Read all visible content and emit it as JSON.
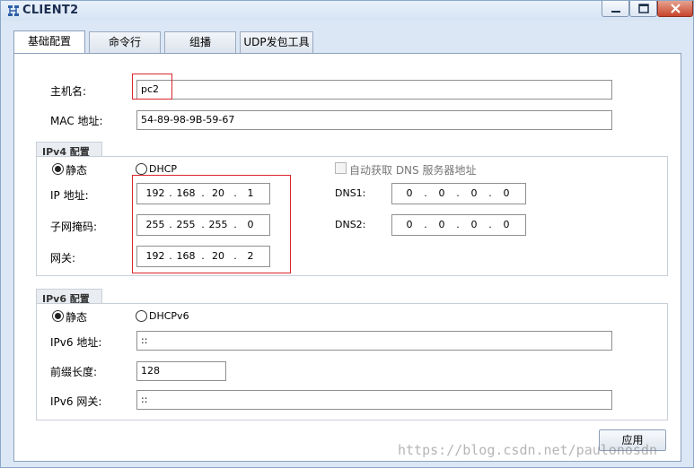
{
  "window": {
    "title": "CLIENT2"
  },
  "tabs": [
    {
      "label": "基础配置",
      "active": true
    },
    {
      "label": "命令行",
      "active": false
    },
    {
      "label": "组播",
      "active": false
    },
    {
      "label": "UDP发包工具",
      "active": false
    }
  ],
  "basic": {
    "hostname_label": "主机名:",
    "hostname_value": "pc2",
    "mac_label": "MAC 地址:",
    "mac_value": "54-89-98-9B-59-67"
  },
  "ipv4": {
    "group_title": "IPv4 配置",
    "static_label": "静态",
    "dhcp_label": "DHCP",
    "mode": "static",
    "auto_dns_label": "自动获取 DNS 服务器地址",
    "auto_dns_checked": false,
    "ip_label": "IP 地址:",
    "ip": [
      "192",
      "168",
      "20",
      "1"
    ],
    "mask_label": "子网掩码:",
    "mask": [
      "255",
      "255",
      "255",
      "0"
    ],
    "gateway_label": "网关:",
    "gateway": [
      "192",
      "168",
      "20",
      "2"
    ],
    "dns1_label": "DNS1:",
    "dns1": [
      "0",
      "0",
      "0",
      "0"
    ],
    "dns2_label": "DNS2:",
    "dns2": [
      "0",
      "0",
      "0",
      "0"
    ]
  },
  "ipv6": {
    "group_title": "IPv6 配置",
    "static_label": "静态",
    "dhcp_label": "DHCPv6",
    "mode": "static",
    "ip_label": "IPv6 地址:",
    "ip_value": "::",
    "prefix_label": "前缀长度:",
    "prefix_value": "128",
    "gateway_label": "IPv6 网关:",
    "gateway_value": "::"
  },
  "actions": {
    "apply_label": "应用"
  },
  "watermark": "https://blog.csdn.net/paulonosdn",
  "colors": {
    "highlight": "#d8262c",
    "window_bg": "#dbe7f5"
  }
}
